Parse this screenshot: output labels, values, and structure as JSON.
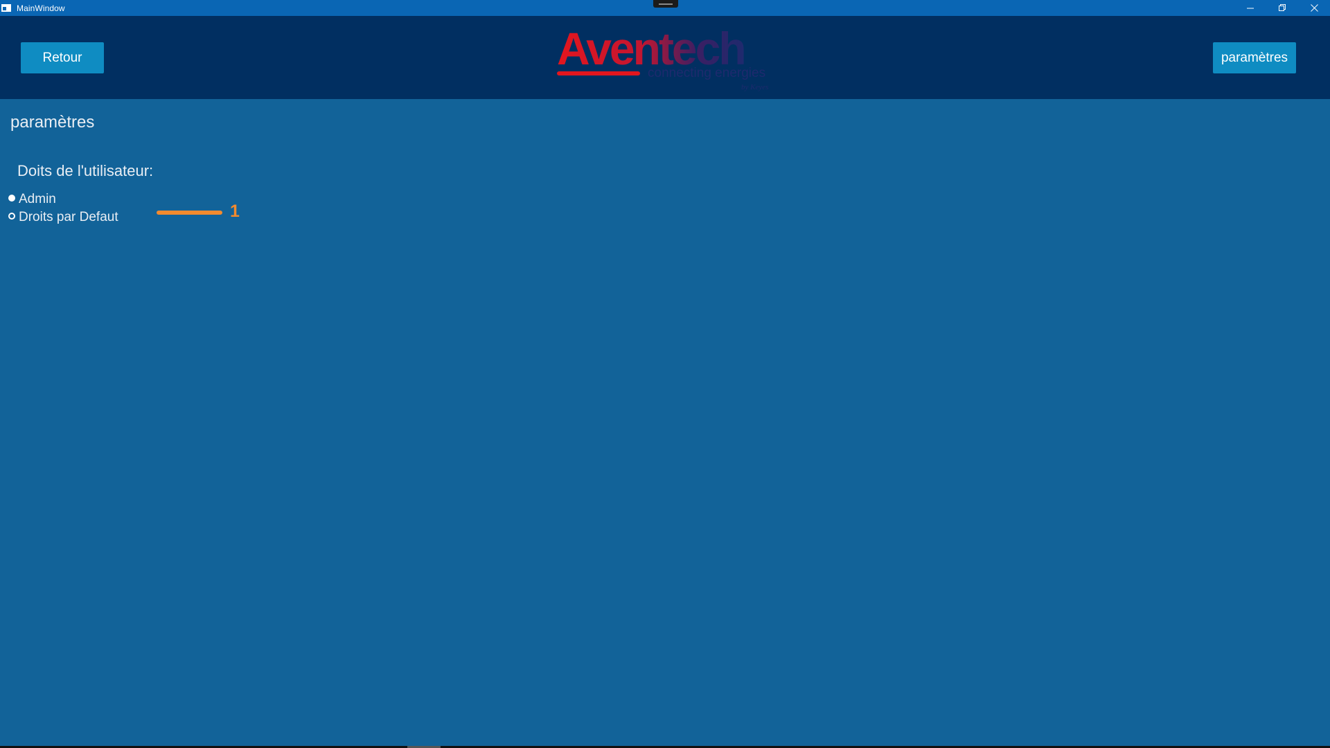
{
  "window": {
    "title": "MainWindow",
    "controls": {
      "minimize": "minimize-icon",
      "restore": "restore-icon",
      "close": "close-icon"
    }
  },
  "header": {
    "back_label": "Retour",
    "settings_label": "paramètres",
    "logo": {
      "name": "Aventech",
      "tagline": "connecting energies",
      "byline": "by Keyes"
    }
  },
  "main": {
    "page_title": "paramètres",
    "section_label": "Doits de l'utilisateur:",
    "radio_options": [
      {
        "label": "Admin",
        "checked": true
      },
      {
        "label": "Droits par Defaut",
        "checked": false
      }
    ],
    "annotation": "1"
  },
  "colors": {
    "titlebar": "#0a66b4",
    "header": "#012f61",
    "content": "#126399",
    "button": "#0f8cc2",
    "logo_red": "#e3161e",
    "logo_navy": "#1e2a6e",
    "annotation": "#f28a2e"
  }
}
